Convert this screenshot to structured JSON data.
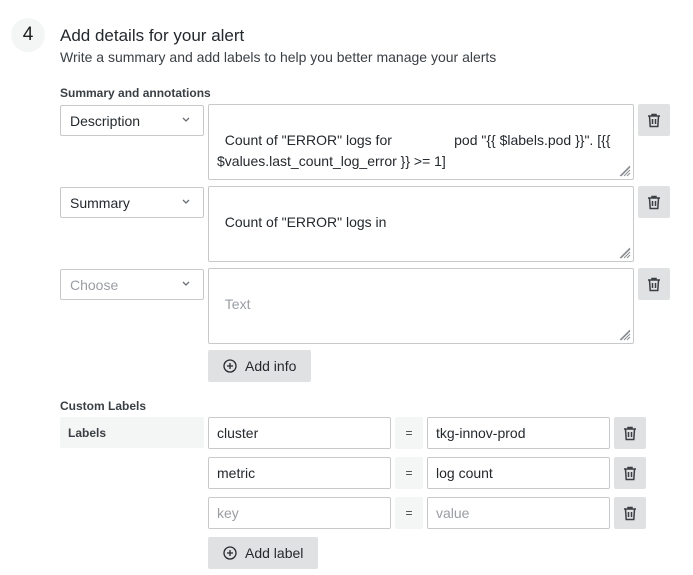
{
  "step": {
    "number": "4",
    "title": "Add details for your alert",
    "subtitle": "Write a summary and add labels to help you better manage your alerts"
  },
  "annotations": {
    "section_label": "Summary and annotations",
    "rows": [
      {
        "key": "Description",
        "key_is_placeholder": false,
        "value": "Count of \"ERROR\" logs for                pod \"{{ $labels.pod }}\". [{{ $values.last_count_log_error }} >= 1]",
        "value_is_placeholder": false
      },
      {
        "key": "Summary",
        "key_is_placeholder": false,
        "value": "Count of \"ERROR\" logs in",
        "value_is_placeholder": false
      },
      {
        "key": "Choose",
        "key_is_placeholder": true,
        "value": "Text",
        "value_is_placeholder": true
      }
    ],
    "add_button_label": "Add info"
  },
  "custom_labels": {
    "section_label": "Custom Labels",
    "tag": "Labels",
    "operator": "=",
    "rows": [
      {
        "key": "cluster",
        "value": "tkg-innov-prod"
      },
      {
        "key": "metric",
        "value": "log count"
      }
    ],
    "empty_row": {
      "key_placeholder": "key",
      "value_placeholder": "value"
    },
    "add_button_label": "Add label"
  },
  "icons": {
    "delete": "trash-icon",
    "add": "plus-circle-icon",
    "dropdown": "chevron-down-icon",
    "resize": "resize-grip-icon"
  },
  "colors": {
    "button_bg": "#e0e1e2",
    "tag_bg": "#f4f5f5",
    "border": "#c7c9cb",
    "placeholder": "#9a9ea3"
  }
}
